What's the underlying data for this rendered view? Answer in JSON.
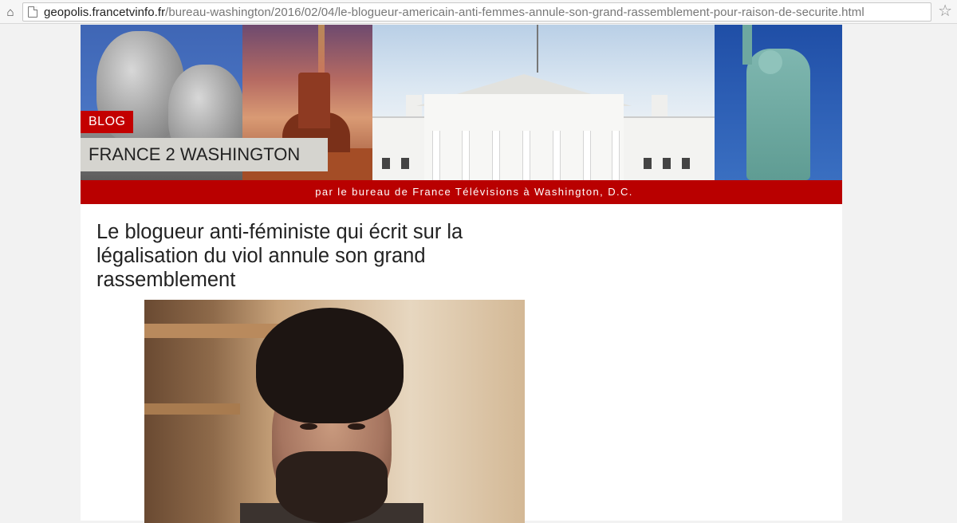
{
  "browser": {
    "url_domain": "geopolis.francetvinfo.fr",
    "url_path": "/bureau-washington/2016/02/04/le-blogueur-americain-anti-femmes-annule-son-grand-rassemblement-pour-raison-de-securite.html",
    "home_icon": "home-icon",
    "bookmark_icon": "star-icon"
  },
  "banner": {
    "blog_label": "BLOG",
    "blog_title": "FRANCE 2 WASHINGTON",
    "strip_text": "par le bureau de France Télévisions à Washington, D.C."
  },
  "article": {
    "title": "Le blogueur anti-féministe qui écrit sur la légalisation du viol annule son grand rassemblement"
  },
  "colors": {
    "accent_red": "#b90000",
    "blog_tag_red": "#c30000",
    "title_box": "#d5d4cf"
  }
}
